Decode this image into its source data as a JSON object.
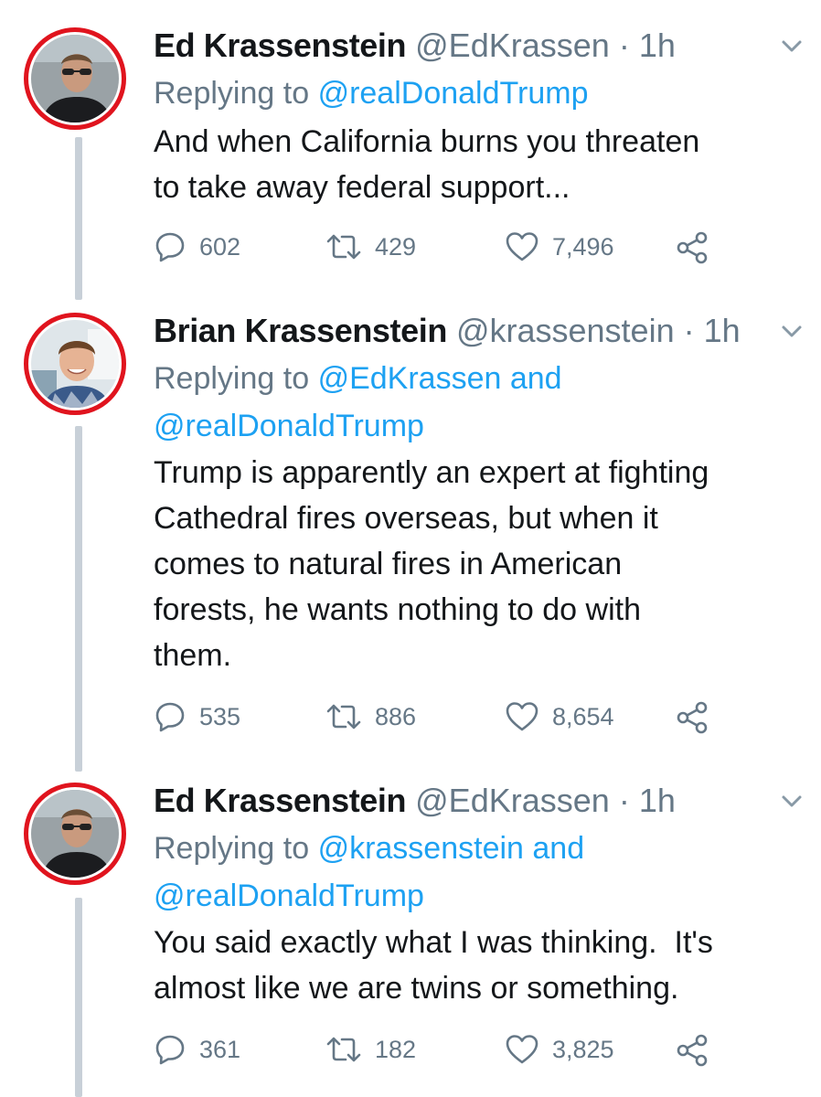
{
  "tweets": [
    {
      "name": "Ed Krassenstein",
      "handle": "@EdKrassen",
      "dot": "·",
      "time": "1h",
      "reply_prefix": "Replying to",
      "reply_line1": "@realDonaldTrump",
      "reply_line2": "",
      "body_lines": [
        "And when California burns you threaten",
        "to take away federal support..."
      ],
      "replies": "602",
      "retweets": "429",
      "likes": "7,496"
    },
    {
      "name": "Brian Krassenstein",
      "handle": "@krassenstein",
      "dot": "·",
      "time": "1h",
      "reply_prefix": "Replying to",
      "reply_line1": "@EdKrassen and",
      "reply_line2": "@realDonaldTrump",
      "body_lines": [
        "Trump is apparently an expert at fighting",
        "Cathedral fires overseas, but when it",
        "comes to natural fires in American",
        "forests, he wants nothing to do with",
        "them."
      ],
      "replies": "535",
      "retweets": "886",
      "likes": "8,654"
    },
    {
      "name": "Ed Krassenstein",
      "handle": "@EdKrassen",
      "dot": "·",
      "time": "1h",
      "reply_prefix": "Replying to",
      "reply_line1": "@krassenstein and",
      "reply_line2": "@realDonaldTrump",
      "body_lines": [
        "You said exactly what I was thinking.  It's",
        "almost like we are twins or something."
      ],
      "replies": "361",
      "retweets": "182",
      "likes": "3,825"
    }
  ],
  "icons": {
    "reply": "reply-icon",
    "retweet": "retweet-icon",
    "like": "heart-icon",
    "share": "share-icon",
    "caret": "chevron-down-icon"
  },
  "colors": {
    "mention": "#1da1f2",
    "secondary": "#657786",
    "avatar_ring": "#e0141e",
    "thread_line": "#c8d0d8"
  }
}
